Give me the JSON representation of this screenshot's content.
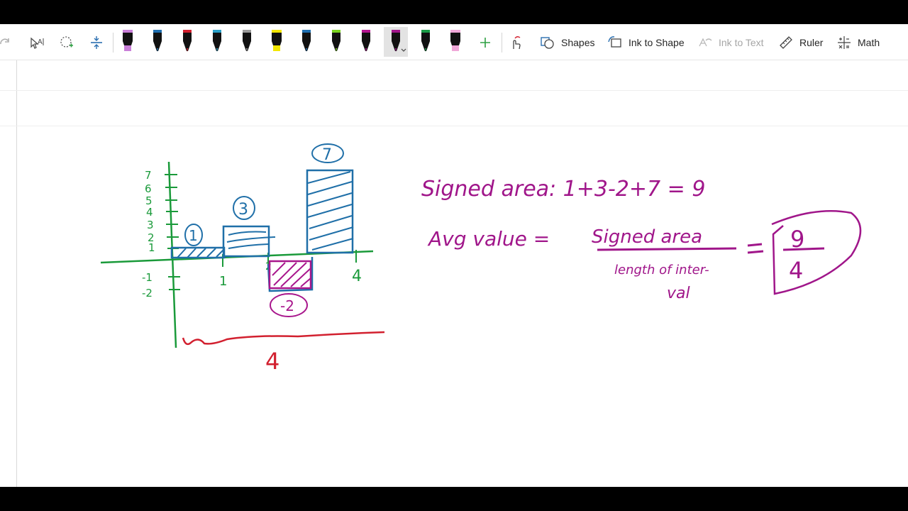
{
  "toolbar": {
    "shapes_label": "Shapes",
    "ink_to_shape_label": "Ink to Shape",
    "ink_to_text_label": "Ink to Text",
    "ruler_label": "Ruler",
    "math_label": "Math"
  },
  "pens": [
    {
      "color": "#111111",
      "tip": "#c97fd8",
      "type": "highlighter"
    },
    {
      "color": "#111111",
      "tip": "#1f6fb0",
      "type": "pen"
    },
    {
      "color": "#111111",
      "tip": "#d2202f",
      "type": "pen"
    },
    {
      "color": "#111111",
      "tip": "#2aa0c8",
      "type": "pen"
    },
    {
      "color": "#111111",
      "tip": "#9a9a9a",
      "type": "pen"
    },
    {
      "color": "#111111",
      "tip": "#f2e600",
      "type": "highlighter"
    },
    {
      "color": "#111111",
      "tip": "#1f6fb0",
      "type": "pen"
    },
    {
      "color": "#111111",
      "tip": "#79d21f",
      "type": "pen"
    },
    {
      "color": "#111111",
      "tip": "#b3168f",
      "type": "pen"
    },
    {
      "color": "#111111",
      "tip": "#a0168a",
      "type": "pen"
    },
    {
      "color": "#111111",
      "tip": "#1a9a46",
      "type": "pen"
    },
    {
      "color": "#111111",
      "tip": "#f0a8d8",
      "type": "highlighter"
    }
  ],
  "colors": {
    "axis": "#1a9a3a",
    "bars": "#1f6fa8",
    "negative": "#a8168c",
    "bracket": "#d2202f",
    "math": "#a0168a"
  },
  "notes": {
    "y_ticks": [
      "7",
      "6",
      "5",
      "4",
      "3",
      "2",
      "1",
      "-1",
      "-2"
    ],
    "x_ticks": [
      "1",
      "2",
      "4"
    ],
    "bar_labels": [
      "1",
      "3",
      "7",
      "-2"
    ],
    "interval_length": "4",
    "signed_area": "Signed area: 1+3-2+7 = 9",
    "avg_lhs": "Avg value =",
    "numerator": "Signed area",
    "denominator_1": "length of inter-",
    "denominator_2": "val",
    "result_num": "9",
    "result_den": "4"
  }
}
